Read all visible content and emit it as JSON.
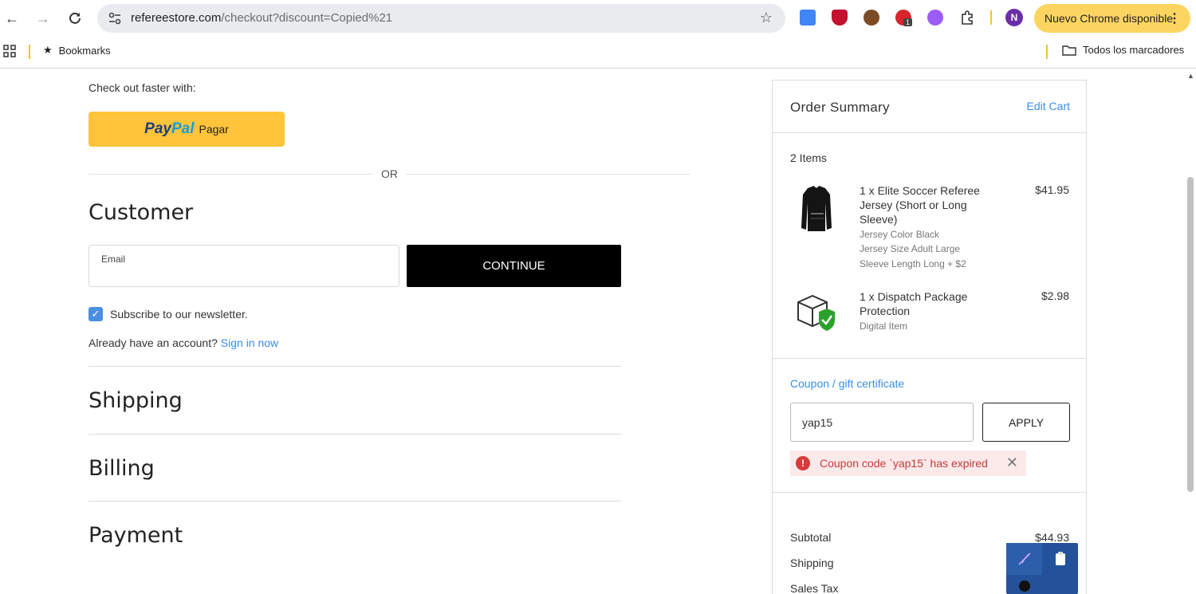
{
  "browser": {
    "url_host": "refereestore.com",
    "url_path": "/checkout?discount=Copied%21",
    "extension_badge": "1",
    "profile_initial": "N",
    "update_label": "Nuevo Chrome disponible",
    "bookmarks_label": "Bookmarks",
    "all_bookmarks_label": "Todos los marcadores"
  },
  "checkout": {
    "faster_label": "Check out faster with:",
    "paypal_pay": "Pay",
    "paypal_pal": "Pal",
    "paypal_action": "Pagar",
    "or_label": "OR",
    "customer_title": "Customer",
    "email_label": "Email",
    "email_value": "",
    "continue_label": "CONTINUE",
    "newsletter_label": "Subscribe to our newsletter.",
    "newsletter_checked": true,
    "account_prompt": "Already have an account?",
    "sign_in_label": "Sign in now",
    "shipping_title": "Shipping",
    "billing_title": "Billing",
    "payment_title": "Payment"
  },
  "summary": {
    "title": "Order Summary",
    "edit_cart": "Edit Cart",
    "items_count": "2 Items",
    "items": [
      {
        "name": "1 x Elite Soccer Referee Jersey (Short or Long Sleeve)",
        "price": "$41.95",
        "options": [
          "Jersey Color Black",
          "Jersey Size Adult Large",
          "Sleeve Length Long + $2"
        ]
      },
      {
        "name": "1 x Dispatch Package Protection",
        "price": "$2.98",
        "options": [
          "Digital Item"
        ]
      }
    ],
    "coupon_label": "Coupon / gift certificate",
    "coupon_value": "yap15",
    "apply_label": "APPLY",
    "error_message": "Coupon code `yap15` has expired",
    "totals": [
      {
        "label": "Subtotal",
        "value": "$44.93"
      },
      {
        "label": "Shipping",
        "value": ""
      },
      {
        "label": "Sales Tax",
        "value": ""
      }
    ]
  },
  "colors": {
    "link": "#3a8ee6",
    "paypal_yellow": "#ffc439",
    "error": "#c23b3b",
    "chrome_update": "#fcd561"
  }
}
